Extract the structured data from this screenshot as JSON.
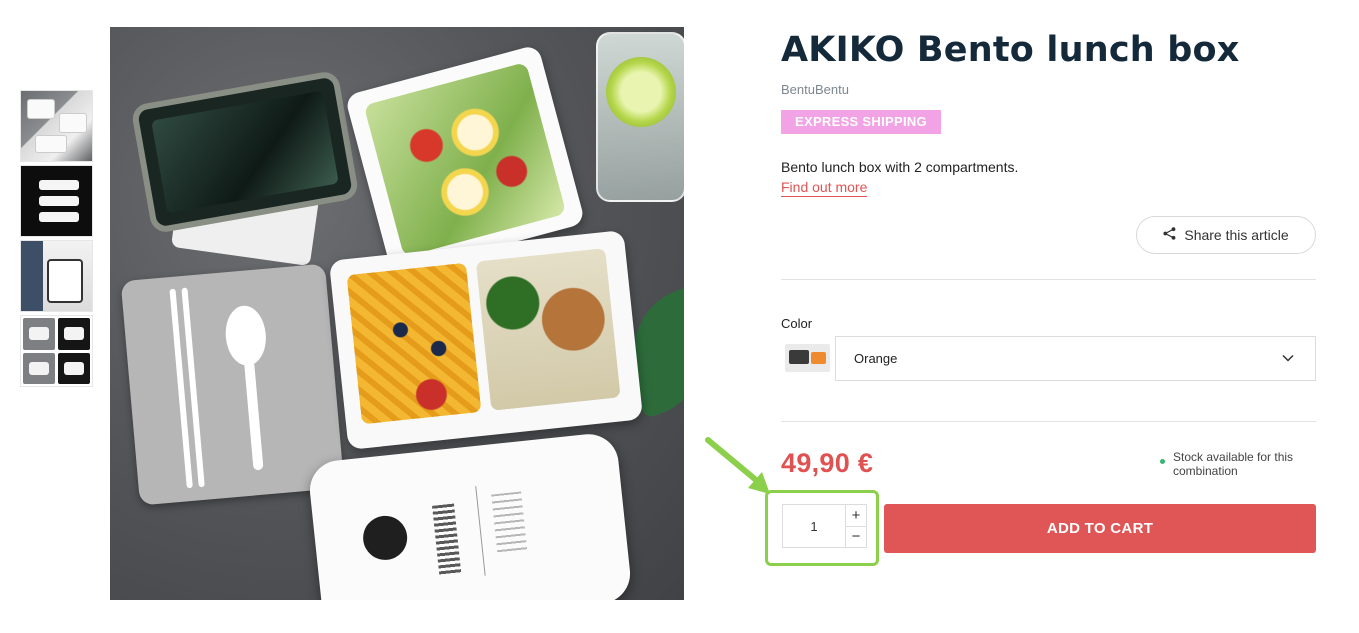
{
  "product": {
    "title": "AKIKO Bento lunch box",
    "brand": "BentuBentu",
    "badge": "EXPRESS SHIPPING",
    "description": "Bento lunch box with 2 compartments.",
    "find_out_more": "Find out more",
    "price": "49,90 €",
    "stock_text": "Stock available for this combination"
  },
  "share": {
    "label": "Share this article",
    "icon": "share-icon"
  },
  "variant": {
    "label": "Color",
    "selected": "Orange",
    "icon": "chevron-down-icon"
  },
  "quantity": {
    "value": "1",
    "increment": "+",
    "decrement": "−"
  },
  "cart": {
    "label": "ADD TO CART"
  },
  "gallery": {
    "thumbnails": [
      "thumb-1",
      "thumb-2",
      "thumb-3",
      "thumb-4"
    ]
  },
  "colors": {
    "accent": "#e05555",
    "badge_bg": "#f2a3e6",
    "title": "#14293a",
    "highlight": "#8bcf4a",
    "stock_dot": "#3cb371"
  }
}
